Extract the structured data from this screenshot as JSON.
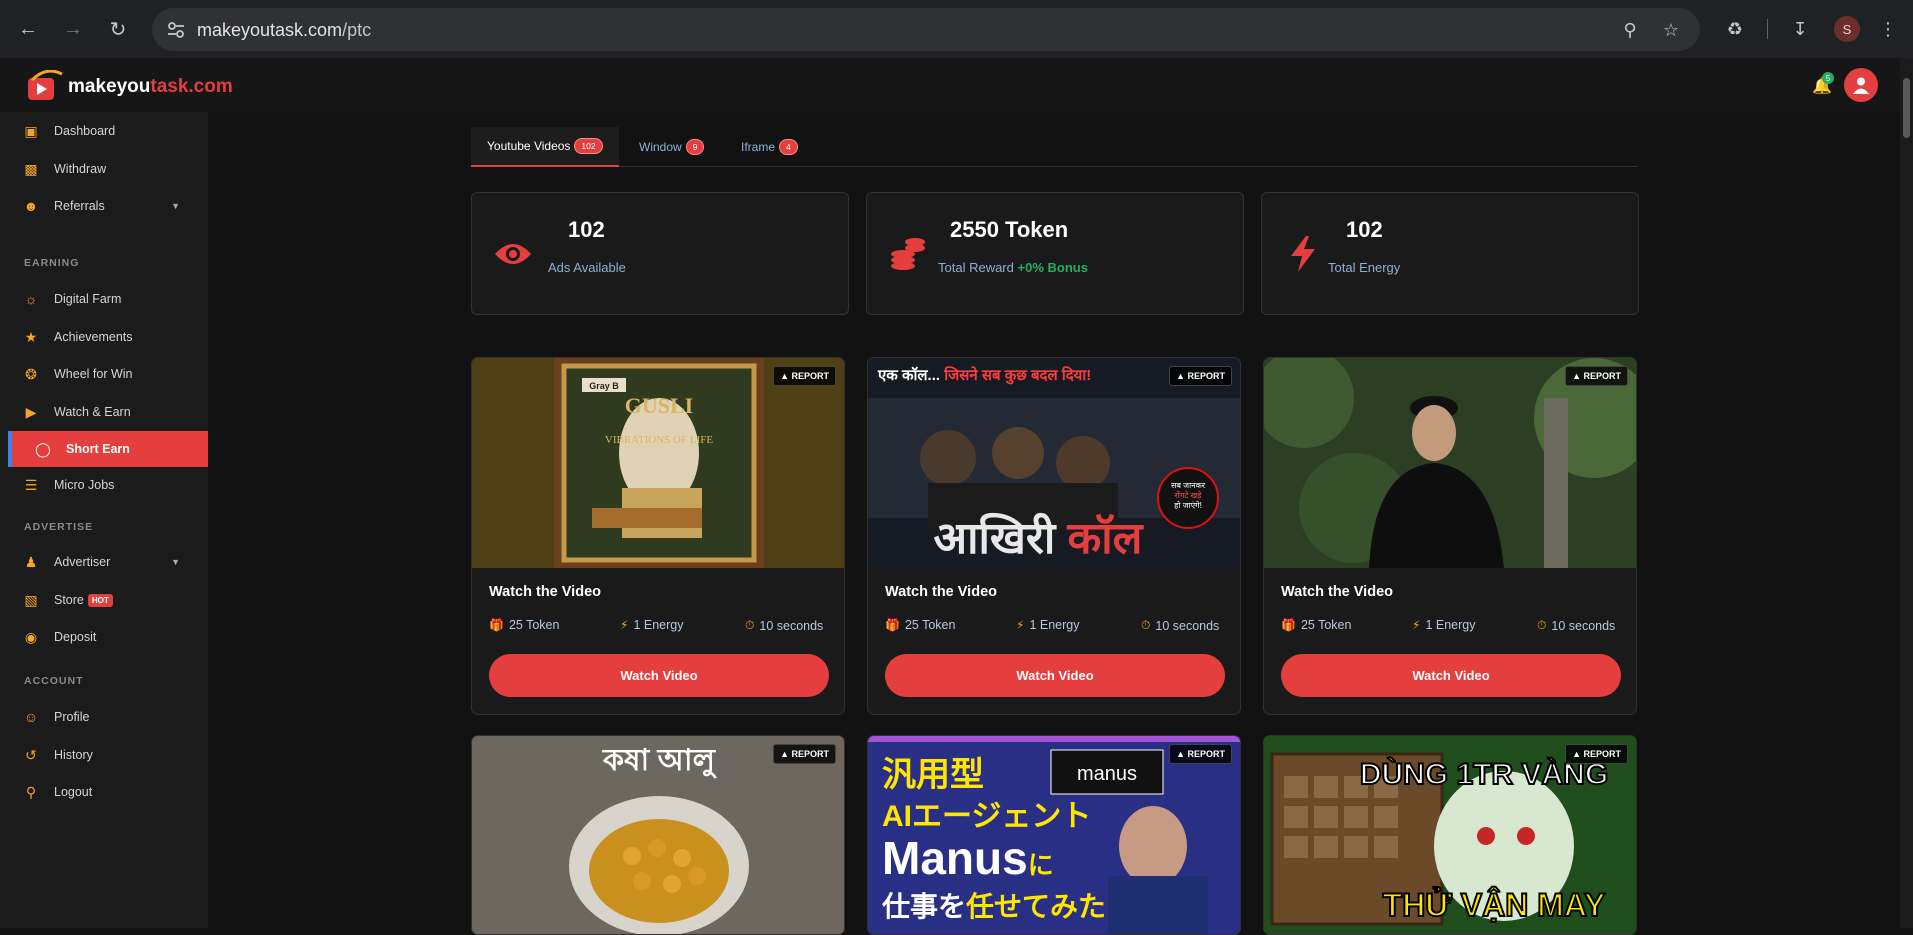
{
  "browser": {
    "url_host": "makeyoutask.com",
    "url_path": "/ptc",
    "profile_initial": "S"
  },
  "brand": {
    "name_part1": "makeyou",
    "name_part2": "task.com",
    "accent_color": "#e53e3e"
  },
  "notifications": {
    "count": "5"
  },
  "sidebar": {
    "items": [
      {
        "label": "Dashboard",
        "icon": "monitor-icon"
      },
      {
        "label": "Withdraw",
        "icon": "wallet-icon"
      },
      {
        "label": "Referrals",
        "icon": "users-icon"
      },
      {
        "label": "Digital Farm",
        "icon": "sun-icon"
      },
      {
        "label": "Achievements",
        "icon": "trophy-icon"
      },
      {
        "label": "Wheel for Win",
        "icon": "wheel-icon"
      },
      {
        "label": "Watch & Earn",
        "icon": "play-icon"
      },
      {
        "label": "Short Earn",
        "icon": "mouse-icon"
      },
      {
        "label": "Micro Jobs",
        "icon": "tasks-icon"
      },
      {
        "label": "Advertiser",
        "icon": "user-icon"
      },
      {
        "label": "Store",
        "icon": "bag-icon",
        "badge": "HOT"
      },
      {
        "label": "Deposit",
        "icon": "deposit-icon"
      },
      {
        "label": "Profile",
        "icon": "profile-icon"
      },
      {
        "label": "History",
        "icon": "history-icon"
      },
      {
        "label": "Logout",
        "icon": "key-icon"
      }
    ],
    "headings": [
      "EARNING",
      "ADVERTISE",
      "ACCOUNT"
    ]
  },
  "tabs": [
    {
      "label": "Youtube Videos",
      "count": "102"
    },
    {
      "label": "Window",
      "count": "9"
    },
    {
      "label": "Iframe",
      "count": "4"
    }
  ],
  "stats": [
    {
      "value": "102",
      "label": "Ads Available"
    },
    {
      "value": "2550 Token",
      "label": "Total Reward",
      "bonus": "+0% Bonus"
    },
    {
      "value": "102",
      "label": "Total Energy"
    }
  ],
  "cards": [
    {
      "title": "Watch the Video",
      "reward": "25 Token",
      "energy": "1 Energy",
      "duration": "10 seconds",
      "button": "Watch Video",
      "report": "REPORT",
      "thumb_text": "GUSLI VIBRATIONS OF LIFE",
      "thumb_brand": "Gray B"
    },
    {
      "title": "Watch the Video",
      "reward": "25 Token",
      "energy": "1 Energy",
      "duration": "10 seconds",
      "button": "Watch Video",
      "report": "REPORT",
      "thumb_top": "एक कॉल... जिसने सब कुछ बदल दिया!",
      "thumb_big": "आखिरी कॉल",
      "thumb_sticker": "सब जानकर रोंगटे खड़े हो जाएंगे!"
    },
    {
      "title": "Watch the Video",
      "reward": "25 Token",
      "energy": "1 Energy",
      "duration": "10 seconds",
      "button": "Watch Video",
      "report": "REPORT"
    },
    {
      "report": "REPORT",
      "thumb_text": "কষা আলু"
    },
    {
      "report": "REPORT",
      "thumb_l1": "汎用型",
      "thumb_l2": "AIエージェント",
      "thumb_l3": "Manus",
      "thumb_l3b": "に",
      "thumb_l4a": "仕事を",
      "thumb_l4b": "任せてみた",
      "thumb_logo": "manus"
    },
    {
      "report": "REPORT",
      "thumb_l1": "DÙNG 1TR VÀNG",
      "thumb_l2": "THỬ VẬN MAY"
    }
  ]
}
